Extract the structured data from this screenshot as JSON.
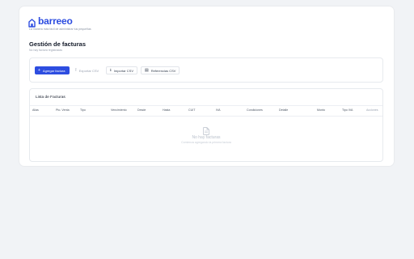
{
  "brand": {
    "name": "barreeo",
    "tagline": "La manera más fácil de administrar tus pequeñas",
    "color": "#2d4de0"
  },
  "page": {
    "title": "Gestión de facturas",
    "subtitle": "No hay factura registradas"
  },
  "toolbar": {
    "add_label": "Agregar factura",
    "export_label": "Exportar CSV",
    "import_label": "Importar CSV",
    "reference_label": "Referencias CSV"
  },
  "table": {
    "title": "Lista de Facturas",
    "columns": [
      "Alias",
      "Pto. Venta",
      "Tipo",
      "Vencimiento",
      "Desde",
      "Hasta",
      "CUIT",
      "IVA",
      "Condiciones",
      "Detalle",
      "Monto",
      "Tipo IVA",
      "Acciones"
    ],
    "empty_title": "No hay facturas",
    "empty_subtitle": "Comienza agregando la primera factura"
  }
}
